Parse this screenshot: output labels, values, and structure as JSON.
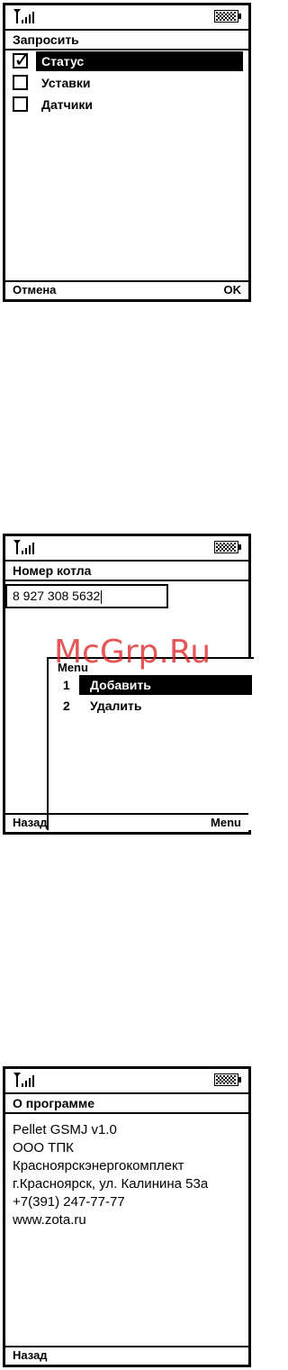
{
  "screen1": {
    "title": "Запросить",
    "items": [
      {
        "label": "Статус",
        "checked": true,
        "selected": true
      },
      {
        "label": "Уставки",
        "checked": false,
        "selected": false
      },
      {
        "label": "Датчики",
        "checked": false,
        "selected": false
      }
    ],
    "checkmark_glyph": "✓",
    "softkey_left": "Отмена",
    "softkey_right": "OK"
  },
  "screen2": {
    "title": "Номер котла",
    "phone_value": "8 927 308 5632",
    "popup": {
      "title": "Menu",
      "items": [
        {
          "number": "1",
          "label": "Добавить",
          "selected": true
        },
        {
          "number": "2",
          "label": "Удалить",
          "selected": false
        }
      ]
    },
    "softkey_left": "Назад",
    "softkey_right": "Menu"
  },
  "screen3": {
    "title": "О программе",
    "lines": [
      "Pellet GSMJ v1.0",
      "ООО ТПК",
      "Красноярскэнергокомплект",
      "г.Красноярск, ул. Калинина 53а",
      "+7(391) 247-77-77",
      "www.zota.ru"
    ],
    "softkey_left": "Назад"
  },
  "watermark": "McGrp.Ru",
  "icons": {
    "signal": "signal-antenna-icon",
    "battery": "battery-icon"
  }
}
